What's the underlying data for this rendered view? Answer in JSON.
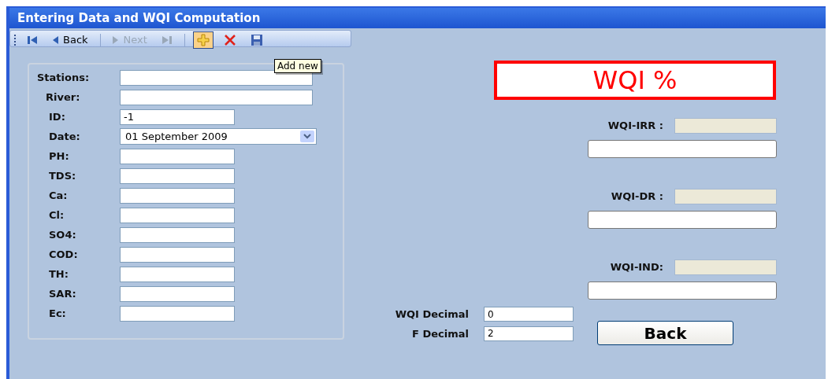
{
  "window": {
    "title": "Entering Data and WQI Computation"
  },
  "toolbar": {
    "items": [
      {
        "kind": "first",
        "disabled": false
      },
      {
        "kind": "prev",
        "label": "Back",
        "disabled": false
      },
      {
        "kind": "separator"
      },
      {
        "kind": "next",
        "label": "Next",
        "disabled": true
      },
      {
        "kind": "last",
        "disabled": true
      },
      {
        "kind": "separator"
      },
      {
        "kind": "add",
        "hovered": true
      },
      {
        "kind": "delete"
      },
      {
        "kind": "save"
      }
    ],
    "tooltip": "Add new"
  },
  "fields": [
    {
      "label": "Stations:",
      "kind": "wide"
    },
    {
      "label": "River:",
      "kind": "wide"
    },
    {
      "label": "ID:",
      "kind": "short",
      "value": "-1"
    },
    {
      "label": "Date:",
      "kind": "date",
      "value": "01 September 2009"
    },
    {
      "label": "PH:",
      "kind": "short"
    },
    {
      "label": "TDS:",
      "kind": "short"
    },
    {
      "label": "Ca:",
      "kind": "short"
    },
    {
      "label": "Cl:",
      "kind": "short"
    },
    {
      "label": "SO4:",
      "kind": "short"
    },
    {
      "label": "COD:",
      "kind": "short"
    },
    {
      "label": "TH:",
      "kind": "short"
    },
    {
      "label": "SAR:",
      "kind": "short"
    },
    {
      "label": "Ec:",
      "kind": "short"
    }
  ],
  "banner": "WQI %",
  "outputs": [
    {
      "label": "WQI-IRR :"
    },
    {
      "label": "WQI-DR :"
    },
    {
      "label": "WQI-IND:"
    }
  ],
  "decimals": [
    {
      "label": "WQI Decimal",
      "value": "0"
    },
    {
      "label": "F Decimal",
      "value": "2"
    }
  ],
  "back_button": "Back"
}
